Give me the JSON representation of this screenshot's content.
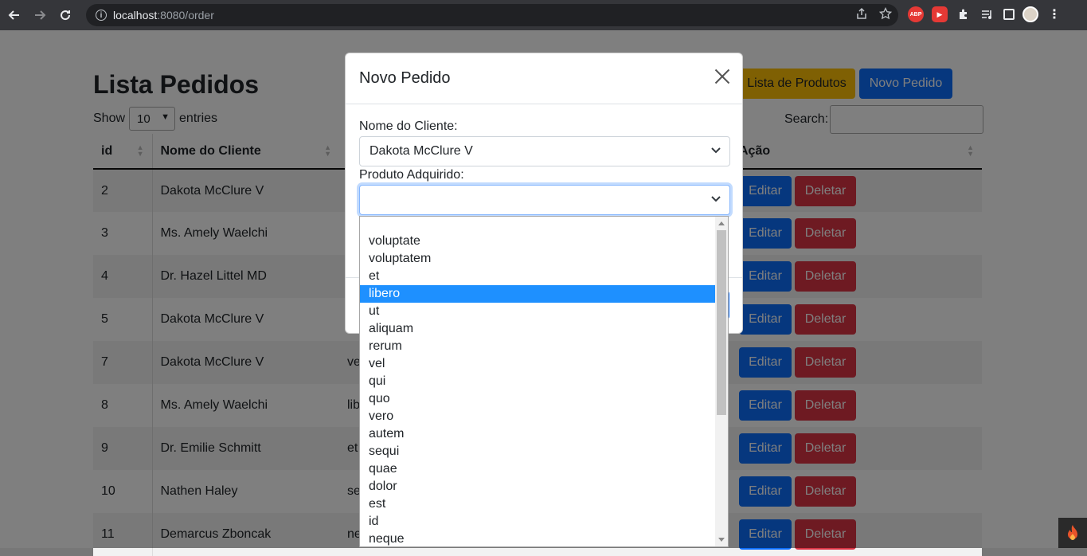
{
  "browser": {
    "url_host": "localhost",
    "url_rest": ":8080/order",
    "extensions": [
      "share-icon",
      "star-icon",
      "adblock-icon",
      "youtube-icon",
      "puzzle-icon",
      "media-icon",
      "sidebar-icon",
      "avatar",
      "menu-icon"
    ],
    "abp_label": "ABP"
  },
  "page": {
    "title": "Lista Pedidos",
    "buttons": {
      "products": "Lista de Produtos",
      "new_order": "Novo Pedido"
    },
    "show_label": "Show",
    "entries_value": "10",
    "entries_label": "entries",
    "search_label": "Search:",
    "columns": [
      "id",
      "Nome do Cliente",
      "",
      "Ação"
    ],
    "rows": [
      {
        "id": "2",
        "client": "Dakota McClure V",
        "product": ""
      },
      {
        "id": "3",
        "client": "Ms. Amely Waelchi",
        "product": ""
      },
      {
        "id": "4",
        "client": "Dr. Hazel Littel MD",
        "product": ""
      },
      {
        "id": "5",
        "client": "Dakota McClure V",
        "product": ""
      },
      {
        "id": "7",
        "client": "Dakota McClure V",
        "product": "ve"
      },
      {
        "id": "8",
        "client": "Ms. Amely Waelchi",
        "product": "lib"
      },
      {
        "id": "9",
        "client": "Dr. Emilie Schmitt",
        "product": "et"
      },
      {
        "id": "10",
        "client": "Nathen Haley",
        "product": "se"
      },
      {
        "id": "11",
        "client": "Demarcus Zboncak",
        "product": "ne"
      }
    ],
    "edit_label": "Editar",
    "delete_label": "Deletar"
  },
  "modal": {
    "title": "Novo Pedido",
    "client_label": "Nome do Cliente:",
    "client_value": "Dakota McClure V",
    "product_label": "Produto Adquirido:",
    "product_value": "",
    "options": [
      "",
      "voluptate",
      "voluptatem",
      "et",
      "libero",
      "ut",
      "aliquam",
      "rerum",
      "vel",
      "qui",
      "quo",
      "vero",
      "autem",
      "sequi",
      "quae",
      "dolor",
      "est",
      "id",
      "neque"
    ],
    "highlighted_option": "libero"
  },
  "colors": {
    "primary": "#0d6efd",
    "warning": "#ffc107",
    "danger": "#dc3545",
    "highlight": "#1e90ff"
  }
}
